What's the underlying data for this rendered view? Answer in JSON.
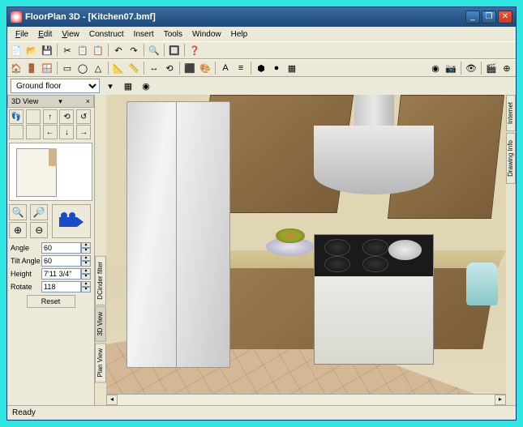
{
  "window": {
    "title": "FloorPlan 3D - [Kitchen07.bmf]"
  },
  "winbtns": {
    "min": "_",
    "max": "❐",
    "close": "✕"
  },
  "menu": {
    "file": "File",
    "edit": "Edit",
    "view": "View",
    "construct": "Construct",
    "insert": "Insert",
    "tools": "Tools",
    "window": "Window",
    "help": "Help"
  },
  "floor": {
    "selector_value": "Ground floor"
  },
  "panel3d": {
    "title": "3D View",
    "close": "×"
  },
  "camera": {
    "angle_label": "Angle",
    "angle_value": "60",
    "tilt_label": "Tilt Angle",
    "tilt_value": "60",
    "height_label": "Height",
    "height_value": "7'11 3/4\"",
    "rotate_label": "Rotate",
    "rotate_value": "118",
    "reset": "Reset"
  },
  "side_tabs": {
    "t1": "DCinder filter",
    "t2": "3D View",
    "t3": "Plan View"
  },
  "right_tabs": {
    "r1": "Internet",
    "r2": "Drawing Info"
  },
  "status": {
    "text": "Ready"
  },
  "toolbar_icons": [
    "📄",
    "📂",
    "💾",
    "",
    "✂",
    "📋",
    "📋",
    "",
    "↶",
    "↷",
    "",
    "🔍",
    "",
    "🔲",
    "",
    "❓"
  ],
  "toolbar2_icons": [
    "🏠",
    "🚪",
    "🪟",
    "",
    "▭",
    "◯",
    "△",
    "",
    "📐",
    "📏",
    "",
    "↔",
    "⟲",
    "",
    "⬛",
    "🎨",
    "",
    "A",
    "≡",
    "",
    "⬢",
    "●",
    "▦"
  ],
  "toolbar3_icons": [
    "◉",
    "📷",
    "",
    "👁",
    "",
    "🎬",
    "⊕"
  ],
  "viewgrid_icons": [
    "👣",
    "",
    "↑",
    "⟲",
    "↺",
    "",
    "",
    "←",
    "↓",
    "→"
  ],
  "camgrid_icons": [
    "🔍",
    "🔎",
    "⊕",
    "⊖"
  ]
}
